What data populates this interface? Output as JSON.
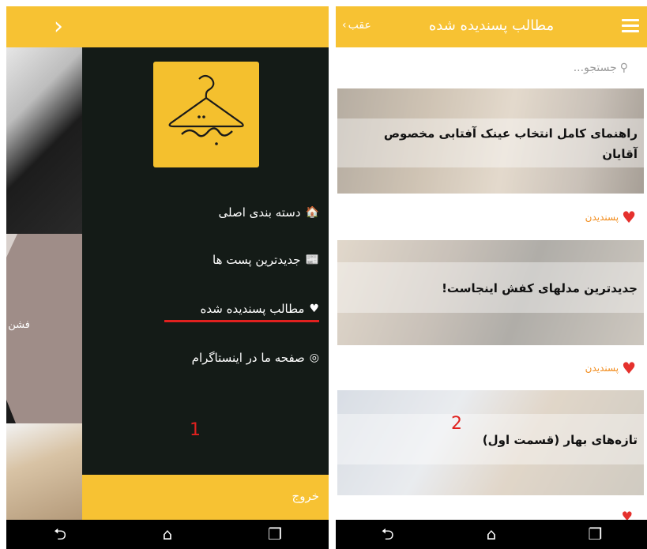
{
  "left": {
    "bg_caption": "فشن آ",
    "drawer": {
      "menu": [
        {
          "icon": "home-icon",
          "glyph": "🏠",
          "label": "دسته بندی اصلی"
        },
        {
          "icon": "newspaper-icon",
          "glyph": "📰",
          "label": "جدیدترین پست ها"
        },
        {
          "icon": "heart-icon",
          "glyph": "♥",
          "label": "مطالب پسندیده شده"
        },
        {
          "icon": "instagram-icon",
          "glyph": "◎",
          "label": "صفحه ما در اینستاگرام"
        }
      ],
      "exit_label": "خروج",
      "annotation": "1"
    }
  },
  "right": {
    "header": {
      "title": "مطالب پسندیده شده",
      "back_label": "عقب"
    },
    "search_placeholder": "جستجو...",
    "cards": [
      {
        "title": "راهنمای کامل انتخاب عینک آفتابی مخصوص آقایان",
        "like_label": "پسندیدن"
      },
      {
        "title": "جدیدترین مدلهای کفش اینجاست!",
        "like_label": "پسندیدن"
      },
      {
        "title": "تازه‌های بهار (قسمت اول)",
        "like_label": ""
      }
    ],
    "annotation": "2"
  },
  "colors": {
    "accent": "#f7c233",
    "drawer_bg": "#141b17",
    "highlight": "#e0211f",
    "like": "#e5312d"
  }
}
